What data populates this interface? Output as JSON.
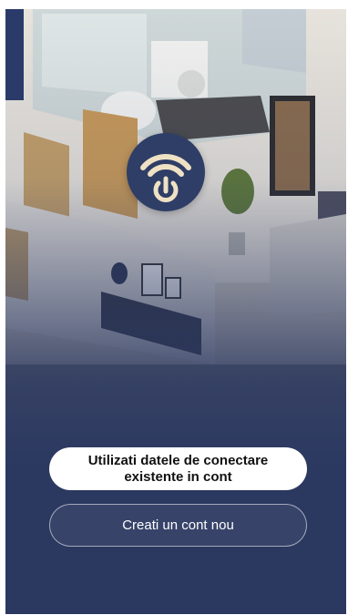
{
  "logo": {
    "icon": "wifi-power-icon",
    "ring_color": "#efe2c4",
    "bg_color": "#2f3e67"
  },
  "actions": {
    "login_existing_label": "Utilizati datele de conectare\nexistente in cont",
    "create_account_label": "Creati un cont nou"
  },
  "colors": {
    "background": "#2b3860",
    "primary_button": "#ffffff",
    "secondary_border": "#ffffff"
  }
}
